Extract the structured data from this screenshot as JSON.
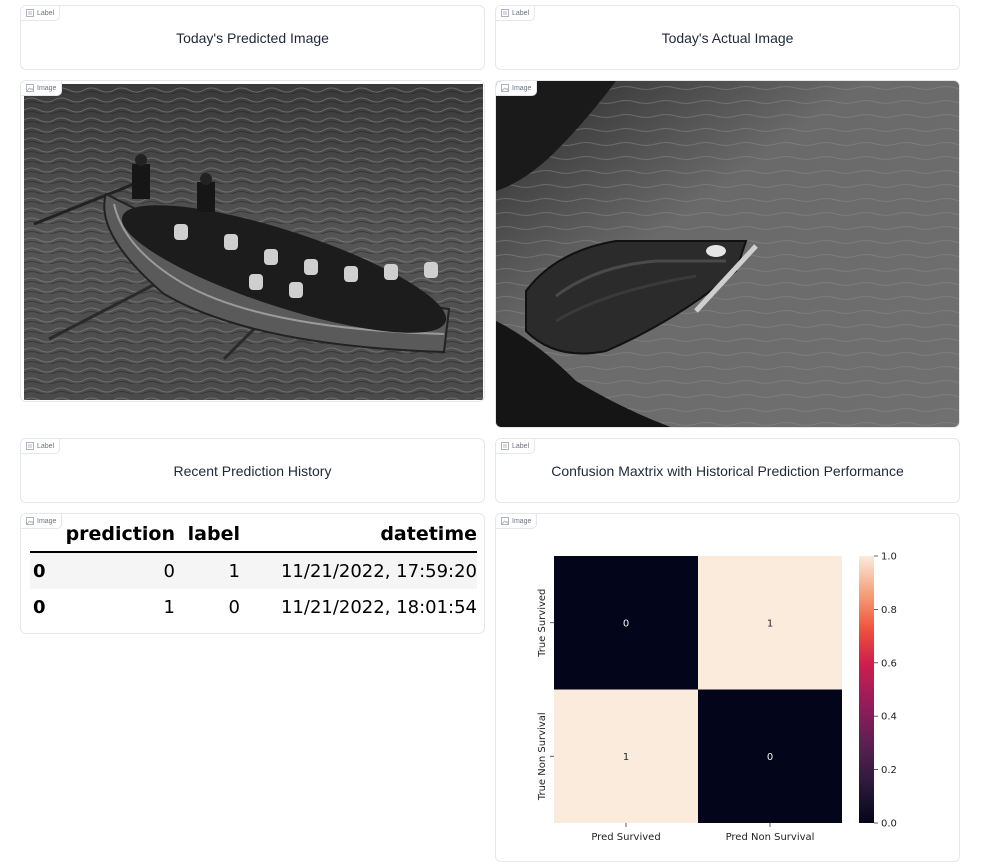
{
  "tag_label": "Label",
  "tag_image": "Image",
  "panels": {
    "predicted_label": "Today's Predicted Image",
    "actual_label": "Today's Actual Image",
    "history_label": "Recent Prediction History",
    "confusion_label": "Confusion Maxtrix with Historical Prediction Performance"
  },
  "history": {
    "headers": [
      "prediction",
      "label",
      "datetime"
    ],
    "rows": [
      {
        "index": "0",
        "prediction": "0",
        "label": "1",
        "datetime": "11/21/2022, 17:59:20"
      },
      {
        "index": "0",
        "prediction": "1",
        "label": "0",
        "datetime": "11/21/2022, 18:01:54"
      }
    ]
  },
  "chart_data": {
    "type": "heatmap",
    "x_categories": [
      "Pred Survived",
      "Pred Non Survival"
    ],
    "y_categories": [
      "True Survived",
      "True Non Survival"
    ],
    "values": [
      [
        0,
        1
      ],
      [
        1,
        0
      ]
    ],
    "annotations": [
      [
        "0",
        "1"
      ],
      [
        "1",
        "0"
      ]
    ],
    "colorbar": {
      "min": 0.0,
      "max": 1.0,
      "ticks": [
        "0.0",
        "0.2",
        "0.4",
        "0.6",
        "0.8",
        "1.0"
      ]
    },
    "colors": {
      "low": "#03051a",
      "high": "#faebdd"
    },
    "legend": "right"
  }
}
